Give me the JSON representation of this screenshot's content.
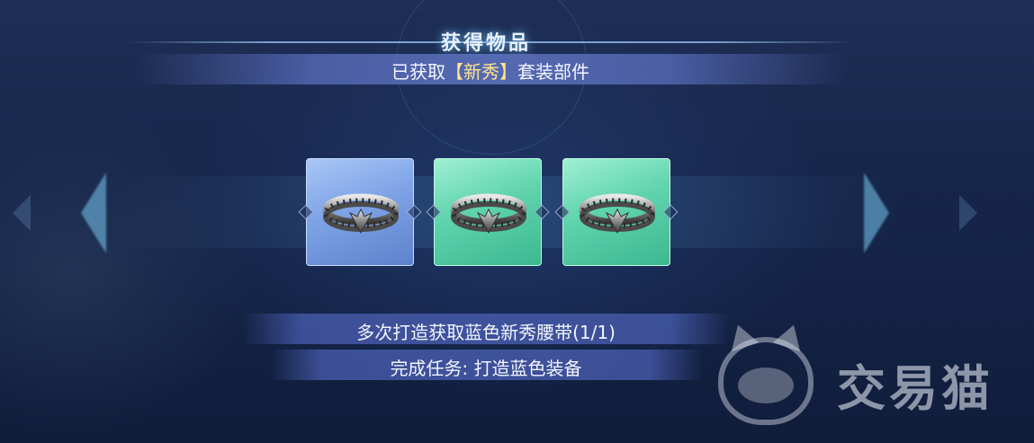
{
  "header": {
    "title": "获得物品",
    "subtitle_prefix": "已获取",
    "subtitle_highlight": "【新秀】",
    "subtitle_suffix": "套装部件"
  },
  "items": [
    {
      "name": "新秀腰带",
      "quality": "blue",
      "icon": "belt-icon"
    },
    {
      "name": "新秀腰带",
      "quality": "green",
      "icon": "belt-icon"
    },
    {
      "name": "新秀腰带",
      "quality": "green",
      "icon": "belt-icon"
    }
  ],
  "tasks": {
    "progress_text": "多次打造获取蓝色新秀腰带(1/1)",
    "quest_text": "完成任务: 打造蓝色装备"
  },
  "watermark": {
    "text": "交易猫",
    "icon": "cat-logo-icon"
  },
  "colors": {
    "blue_slot": "#7ea3e6",
    "green_slot": "#5fd3ad",
    "highlight": "#ffe58f"
  }
}
